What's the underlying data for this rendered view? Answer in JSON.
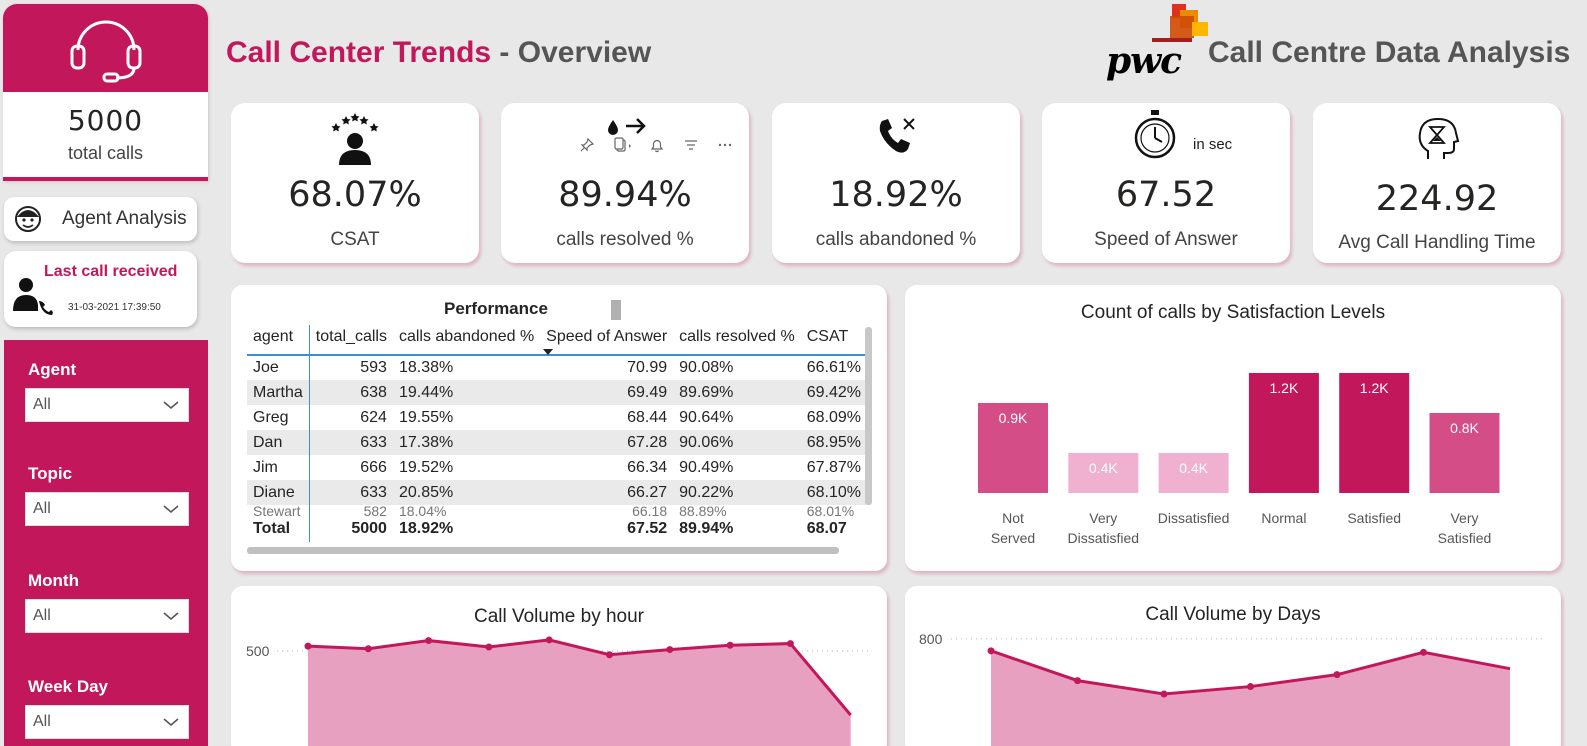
{
  "sidebar": {
    "total_calls_value": "5000",
    "total_calls_label": "total  calls",
    "agent_analysis_label": "Agent Analysis",
    "last_call_title": "Last call received",
    "last_call_time": "31-03-2021 17:39:50",
    "filters": [
      {
        "label": "Agent",
        "value": "All"
      },
      {
        "label": "Topic",
        "value": "All"
      },
      {
        "label": "Month",
        "value": "All"
      },
      {
        "label": "Week Day",
        "value": "All"
      }
    ]
  },
  "header": {
    "title_part1": "Call Center Trends",
    "title_sep": " - ",
    "title_part2": "Overview",
    "brand_logo_text": "pwc",
    "brand_title": "Call Centre Data Analysis"
  },
  "kpis": [
    {
      "value": "68.07%",
      "label": "CSAT",
      "icon": "satisfaction-stars-icon"
    },
    {
      "value": "89.94%",
      "label": "calls resolved %",
      "icon": "resolved-arrow-icon"
    },
    {
      "value": "18.92%",
      "label": "calls abandoned %",
      "icon": "phone-abandoned-icon"
    },
    {
      "value": "67.52",
      "label": "Speed of Answer",
      "unit": "in sec",
      "icon": "stopwatch-icon"
    },
    {
      "value": "224.92",
      "label": "Avg Call Handling Time",
      "icon": "hourglass-head-icon"
    }
  ],
  "performance": {
    "title": "Performance",
    "columns": [
      "agent",
      "total_calls",
      "calls abandoned %",
      "Speed of Answer",
      "calls resolved %",
      "CSAT"
    ],
    "rows": [
      [
        "Joe",
        "593",
        "18.38%",
        "70.99",
        "90.08%",
        "66.61%"
      ],
      [
        "Martha",
        "638",
        "19.44%",
        "69.49",
        "89.69%",
        "69.42%"
      ],
      [
        "Greg",
        "624",
        "19.55%",
        "68.44",
        "90.64%",
        "68.09%"
      ],
      [
        "Dan",
        "633",
        "17.38%",
        "67.28",
        "90.06%",
        "68.95%"
      ],
      [
        "Jim",
        "666",
        "19.52%",
        "66.34",
        "90.49%",
        "67.87%"
      ],
      [
        "Diane",
        "633",
        "20.85%",
        "66.27",
        "90.22%",
        "68.10%"
      ],
      [
        "Stewart",
        "582",
        "18.04%",
        "66.18",
        "88.89%",
        "68.01%"
      ]
    ],
    "total": [
      "Total",
      "5000",
      "18.92%",
      "67.52",
      "89.94%",
      "68.07"
    ]
  },
  "chart_data": [
    {
      "type": "bar",
      "title": "Count of calls by Satisfaction Levels",
      "categories": [
        "Not Served",
        "Very Dissatisfied",
        "Dissatisfied",
        "Normal",
        "Satisfied",
        "Very Satisfied"
      ],
      "values": [
        900,
        400,
        400,
        1200,
        1200,
        800
      ],
      "data_labels": [
        "0.9K",
        "0.4K",
        "0.4K",
        "1.2K",
        "1.2K",
        "0.8K"
      ],
      "colors": [
        "#d44d86",
        "#f0b0d0",
        "#f0b0d0",
        "#c2185b",
        "#c2185b",
        "#d44d86"
      ]
    },
    {
      "type": "area",
      "title": "Call Volume by hour",
      "y_tick": 500,
      "values": [
        522,
        510,
        548,
        518,
        551,
        482,
        506,
        526,
        534,
        200
      ],
      "ylim": [
        0,
        560
      ]
    },
    {
      "type": "area",
      "title": "Call Volume by Days",
      "y_tick": 800,
      "values": [
        720,
        520,
        430,
        480,
        560,
        710,
        600
      ],
      "ylim": [
        0,
        860
      ]
    }
  ],
  "colors": {
    "accent": "#c2185b",
    "accent_light": "#e8a0c0",
    "mid": "#d44d86",
    "light": "#f0b0d0"
  }
}
